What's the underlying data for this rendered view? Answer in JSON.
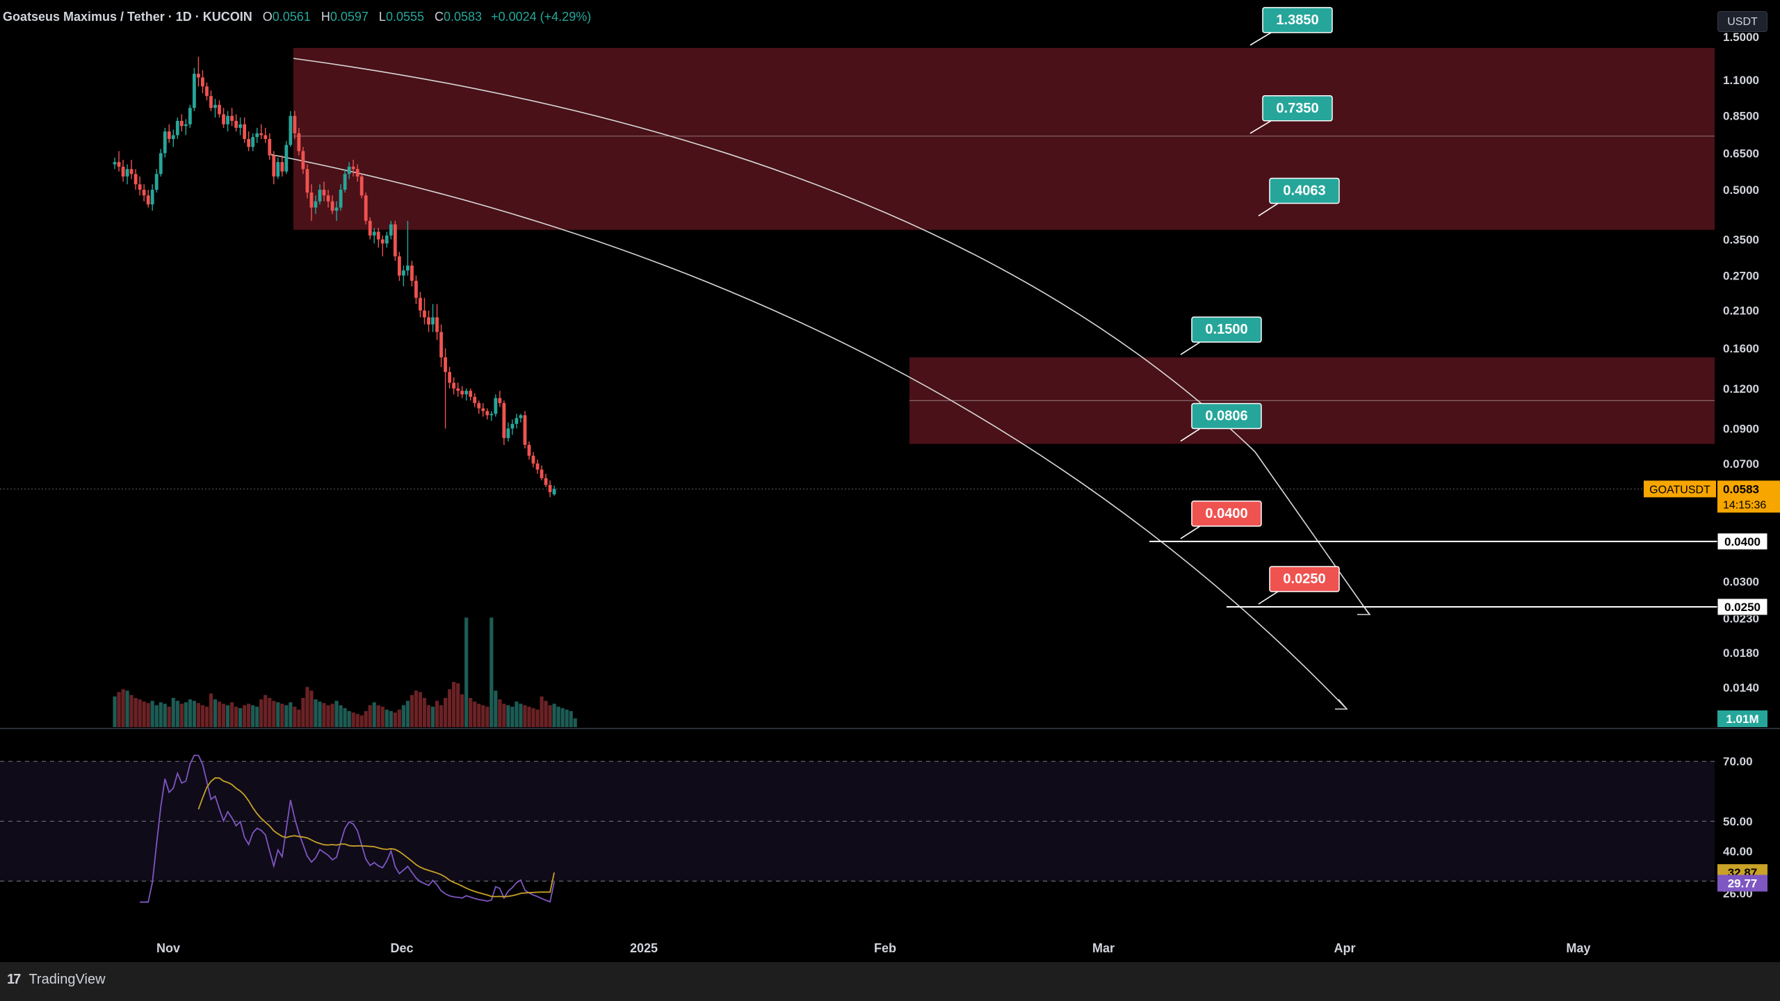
{
  "header": {
    "symbol": "Goatseus Maximus / Tether · 1D · KUCOIN",
    "open_label": "O",
    "open": "0.0561",
    "high_label": "H",
    "high": "0.0597",
    "low_label": "L",
    "low": "0.0555",
    "close_label": "C",
    "close": "0.0583",
    "change": "+0.0024 (+4.29%)"
  },
  "currency": "USDT",
  "footer": {
    "brand": "TradingView",
    "logo": "17"
  },
  "colors": {
    "up": "#26a69a",
    "down": "#ef5350",
    "zone": "#4a1118",
    "rsi": "#7e57c2",
    "rsi_ma": "#c9a227",
    "price_tag": "#f7a600"
  },
  "chart_data": [
    {
      "type": "candlestick",
      "scale": "log",
      "ylim": [
        0.012,
        1.6
      ],
      "x_ticks": [
        "Nov",
        "Dec",
        "2025",
        "Feb",
        "Mar",
        "Apr",
        "May"
      ],
      "y_ticks": [
        "1.5000",
        "1.1000",
        "0.8500",
        "0.6500",
        "0.5000",
        "0.3500",
        "0.2700",
        "0.2100",
        "0.1600",
        "0.1200",
        "0.0900",
        "0.0700",
        "0.0300",
        "0.0230",
        "0.0180",
        "0.0140"
      ],
      "series": [
        {
          "values": [
            [
              0.6,
              0.63,
              0.58,
              0.61
            ],
            [
              0.61,
              0.66,
              0.57,
              0.59
            ],
            [
              0.59,
              0.62,
              0.53,
              0.55
            ],
            [
              0.55,
              0.6,
              0.52,
              0.58
            ],
            [
              0.58,
              0.62,
              0.54,
              0.56
            ],
            [
              0.56,
              0.58,
              0.5,
              0.52
            ],
            [
              0.52,
              0.55,
              0.48,
              0.5
            ],
            [
              0.5,
              0.52,
              0.46,
              0.48
            ],
            [
              0.48,
              0.5,
              0.44,
              0.45
            ],
            [
              0.45,
              0.52,
              0.43,
              0.5
            ],
            [
              0.5,
              0.58,
              0.49,
              0.56
            ],
            [
              0.56,
              0.67,
              0.55,
              0.65
            ],
            [
              0.65,
              0.78,
              0.63,
              0.76
            ],
            [
              0.76,
              0.8,
              0.7,
              0.72
            ],
            [
              0.72,
              0.77,
              0.68,
              0.74
            ],
            [
              0.74,
              0.84,
              0.72,
              0.82
            ],
            [
              0.82,
              0.86,
              0.76,
              0.79
            ],
            [
              0.79,
              0.83,
              0.74,
              0.8
            ],
            [
              0.8,
              0.92,
              0.78,
              0.9
            ],
            [
              0.9,
              1.2,
              0.88,
              1.15
            ],
            [
              1.15,
              1.3,
              1.05,
              1.12
            ],
            [
              1.12,
              1.18,
              1.0,
              1.05
            ],
            [
              1.05,
              1.08,
              0.95,
              0.98
            ],
            [
              0.98,
              1.02,
              0.88,
              0.9
            ],
            [
              0.9,
              0.96,
              0.84,
              0.92
            ],
            [
              0.92,
              0.95,
              0.84,
              0.86
            ],
            [
              0.86,
              0.9,
              0.78,
              0.8
            ],
            [
              0.8,
              0.88,
              0.76,
              0.85
            ],
            [
              0.85,
              0.9,
              0.79,
              0.82
            ],
            [
              0.82,
              0.86,
              0.76,
              0.78
            ],
            [
              0.78,
              0.84,
              0.74,
              0.8
            ],
            [
              0.8,
              0.84,
              0.7,
              0.72
            ],
            [
              0.72,
              0.76,
              0.66,
              0.68
            ],
            [
              0.68,
              0.75,
              0.66,
              0.73
            ],
            [
              0.73,
              0.78,
              0.7,
              0.75
            ],
            [
              0.75,
              0.8,
              0.72,
              0.74
            ],
            [
              0.74,
              0.78,
              0.7,
              0.72
            ],
            [
              0.72,
              0.75,
              0.62,
              0.64
            ],
            [
              0.64,
              0.66,
              0.52,
              0.55
            ],
            [
              0.55,
              0.63,
              0.54,
              0.61
            ],
            [
              0.61,
              0.64,
              0.55,
              0.57
            ],
            [
              0.57,
              0.71,
              0.56,
              0.69
            ],
            [
              0.69,
              0.88,
              0.68,
              0.85
            ],
            [
              0.85,
              0.88,
              0.72,
              0.75
            ],
            [
              0.75,
              0.78,
              0.64,
              0.66
            ],
            [
              0.66,
              0.68,
              0.56,
              0.58
            ],
            [
              0.58,
              0.6,
              0.47,
              0.49
            ],
            [
              0.49,
              0.52,
              0.4,
              0.44
            ],
            [
              0.44,
              0.48,
              0.42,
              0.46
            ],
            [
              0.46,
              0.52,
              0.45,
              0.5
            ],
            [
              0.5,
              0.53,
              0.46,
              0.48
            ],
            [
              0.48,
              0.5,
              0.44,
              0.46
            ],
            [
              0.46,
              0.48,
              0.42,
              0.43
            ],
            [
              0.43,
              0.46,
              0.4,
              0.44
            ],
            [
              0.44,
              0.52,
              0.43,
              0.5
            ],
            [
              0.5,
              0.58,
              0.49,
              0.56
            ],
            [
              0.56,
              0.61,
              0.54,
              0.59
            ],
            [
              0.59,
              0.62,
              0.55,
              0.58
            ],
            [
              0.58,
              0.6,
              0.53,
              0.55
            ],
            [
              0.55,
              0.56,
              0.47,
              0.48
            ],
            [
              0.48,
              0.49,
              0.39,
              0.4
            ],
            [
              0.4,
              0.41,
              0.35,
              0.36
            ],
            [
              0.36,
              0.38,
              0.34,
              0.37
            ],
            [
              0.37,
              0.38,
              0.33,
              0.35
            ],
            [
              0.35,
              0.36,
              0.31,
              0.34
            ],
            [
              0.34,
              0.37,
              0.33,
              0.36
            ],
            [
              0.36,
              0.4,
              0.35,
              0.39
            ],
            [
              0.39,
              0.4,
              0.3,
              0.31
            ],
            [
              0.31,
              0.32,
              0.26,
              0.27
            ],
            [
              0.27,
              0.29,
              0.25,
              0.28
            ],
            [
              0.28,
              0.4,
              0.27,
              0.29
            ],
            [
              0.29,
              0.3,
              0.25,
              0.26
            ],
            [
              0.26,
              0.27,
              0.22,
              0.23
            ],
            [
              0.23,
              0.24,
              0.2,
              0.21
            ],
            [
              0.21,
              0.23,
              0.19,
              0.2
            ],
            [
              0.2,
              0.21,
              0.18,
              0.19
            ],
            [
              0.19,
              0.22,
              0.18,
              0.2
            ],
            [
              0.2,
              0.22,
              0.17,
              0.18
            ],
            [
              0.18,
              0.19,
              0.14,
              0.15
            ],
            [
              0.15,
              0.16,
              0.09,
              0.135
            ],
            [
              0.135,
              0.14,
              0.12,
              0.125
            ],
            [
              0.125,
              0.13,
              0.115,
              0.12
            ],
            [
              0.12,
              0.125,
              0.113,
              0.118
            ],
            [
              0.118,
              0.122,
              0.112,
              0.115
            ],
            [
              0.115,
              0.12,
              0.11,
              0.118
            ],
            [
              0.118,
              0.12,
              0.11,
              0.113
            ],
            [
              0.113,
              0.116,
              0.105,
              0.108
            ],
            [
              0.108,
              0.11,
              0.1,
              0.104
            ],
            [
              0.104,
              0.108,
              0.098,
              0.102
            ],
            [
              0.102,
              0.104,
              0.096,
              0.099
            ],
            [
              0.099,
              0.102,
              0.095,
              0.1
            ],
            [
              0.1,
              0.115,
              0.098,
              0.112
            ],
            [
              0.112,
              0.118,
              0.105,
              0.108
            ],
            [
              0.108,
              0.11,
              0.08,
              0.084
            ],
            [
              0.084,
              0.094,
              0.082,
              0.09
            ],
            [
              0.09,
              0.096,
              0.086,
              0.093
            ],
            [
              0.093,
              0.1,
              0.09,
              0.097
            ],
            [
              0.097,
              0.1,
              0.094,
              0.099
            ],
            [
              0.099,
              0.102,
              0.078,
              0.08
            ],
            [
              0.08,
              0.082,
              0.072,
              0.074
            ],
            [
              0.074,
              0.076,
              0.068,
              0.07
            ],
            [
              0.07,
              0.072,
              0.065,
              0.067
            ],
            [
              0.067,
              0.069,
              0.062,
              0.063
            ],
            [
              0.063,
              0.065,
              0.059,
              0.06
            ],
            [
              0.06,
              0.062,
              0.055,
              0.057
            ],
            [
              0.0561,
              0.0597,
              0.0555,
              0.0583
            ]
          ]
        }
      ],
      "zones": [
        {
          "from": 0.375,
          "to": 1.385,
          "mid": 0.735
        },
        {
          "from": 0.0806,
          "to": 0.15,
          "mid": 0.11
        }
      ],
      "levels": [
        {
          "label": "1.3850",
          "value": 1.385,
          "color": "#26a69a"
        },
        {
          "label": "0.7350",
          "value": 0.735,
          "color": "#26a69a"
        },
        {
          "label": "0.4063",
          "value": 0.4063,
          "color": "#26a69a"
        },
        {
          "label": "0.1500",
          "value": 0.15,
          "color": "#26a69a"
        },
        {
          "label": "0.0806",
          "value": 0.0806,
          "color": "#26a69a"
        },
        {
          "label": "0.0400",
          "value": 0.04,
          "color": "#ef5350"
        },
        {
          "label": "0.0250",
          "value": 0.025,
          "color": "#ef5350"
        }
      ],
      "axis_labels": [
        {
          "text": "0.0400",
          "value": 0.04
        },
        {
          "text": "0.0250",
          "value": 0.025
        }
      ],
      "price_tag": {
        "symbol": "GOATUSDT",
        "price": "0.0583",
        "countdown": "14:15:36"
      },
      "volume_tag": "1.01M",
      "volume": [
        42,
        48,
        52,
        50,
        44,
        40,
        38,
        35,
        33,
        36,
        30,
        34,
        32,
        28,
        40,
        36,
        32,
        34,
        38,
        36,
        33,
        30,
        28,
        46,
        38,
        35,
        32,
        30,
        34,
        28,
        26,
        30,
        32,
        30,
        28,
        38,
        44,
        40,
        36,
        34,
        32,
        30,
        34,
        28,
        24,
        40,
        55,
        50,
        38,
        35,
        33,
        30,
        32,
        36,
        30,
        26,
        22,
        20,
        18,
        16,
        22,
        30,
        34,
        30,
        28,
        24,
        22,
        20,
        24,
        30,
        36,
        44,
        50,
        48,
        40,
        30,
        28,
        36,
        30,
        40,
        52,
        62,
        60,
        45,
        150,
        40,
        35,
        32,
        30,
        28,
        150,
        50,
        38,
        32,
        30,
        28,
        35,
        32,
        30,
        28,
        26,
        24,
        42,
        36,
        30,
        32,
        28,
        26,
        24,
        22,
        12
      ]
    },
    {
      "type": "line",
      "name": "RSI",
      "ylim": [
        22,
        74
      ],
      "y_ticks": [
        "70.00",
        "50.00",
        "40.00",
        "26.00"
      ],
      "bands": [
        70,
        50,
        30
      ],
      "rsi_value": "29.77",
      "ma_value": "32.87"
    }
  ]
}
